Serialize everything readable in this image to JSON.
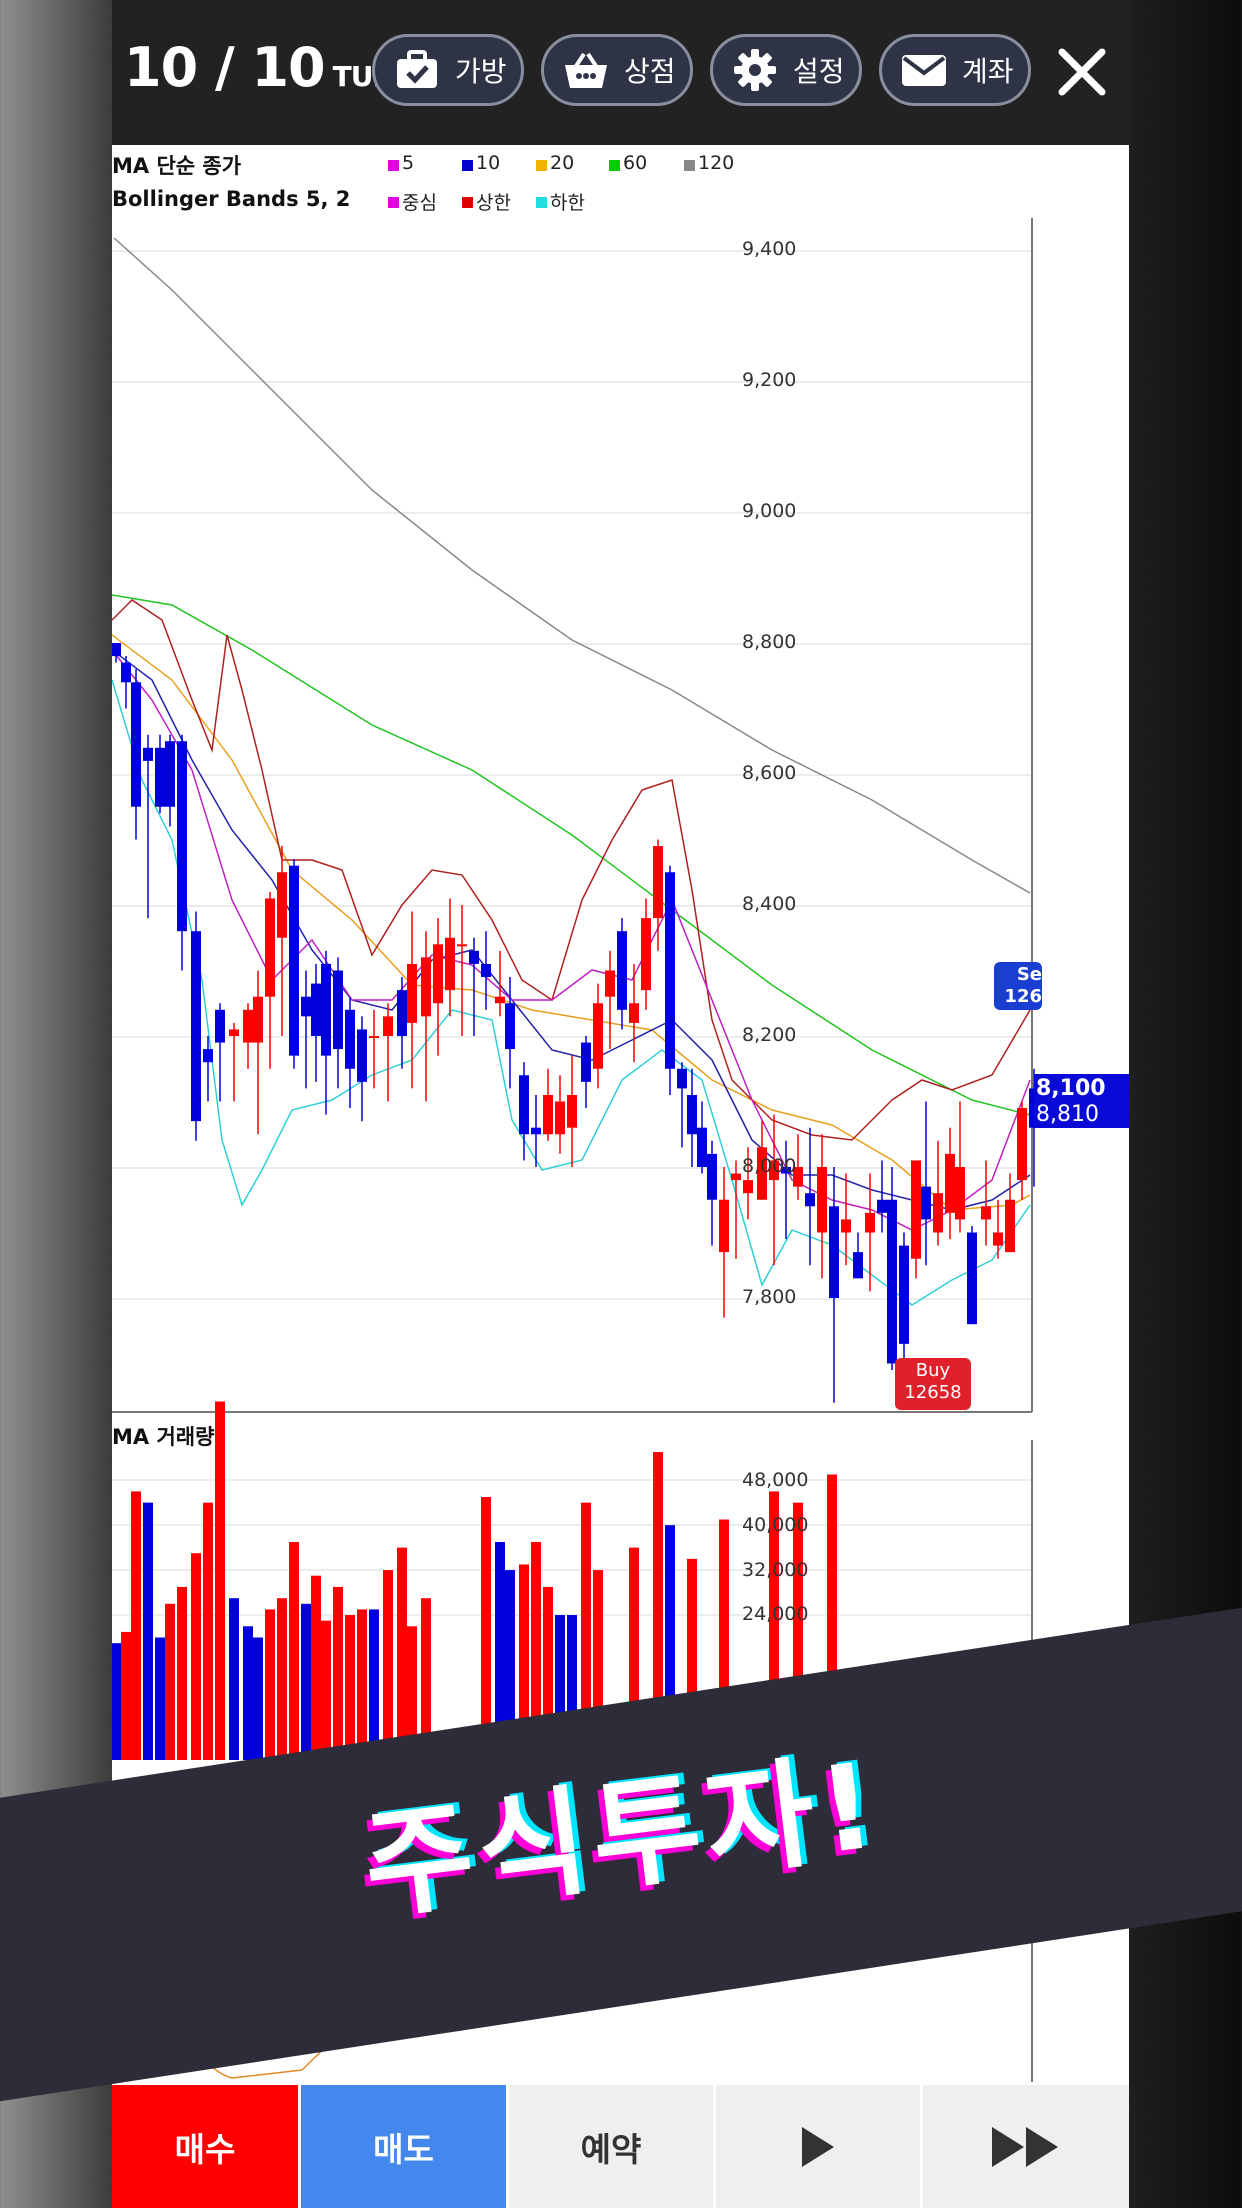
{
  "header": {
    "turn_main": "10 / 10",
    "turn_suffix": "TURN",
    "buttons": [
      {
        "label": "가방",
        "icon": "briefcase-check-icon"
      },
      {
        "label": "상점",
        "icon": "shopping-basket-icon"
      },
      {
        "label": "설정",
        "icon": "gear-icon"
      },
      {
        "label": "계좌",
        "icon": "envelope-icon"
      }
    ],
    "close_icon": "close-icon"
  },
  "legend": {
    "ma_title": "MA 단순 종가",
    "ma_items": [
      {
        "label": "5",
        "color": "#e000e0"
      },
      {
        "label": "10",
        "color": "#0000cc"
      },
      {
        "label": "20",
        "color": "#f0b400"
      },
      {
        "label": "60",
        "color": "#00cc00"
      },
      {
        "label": "120",
        "color": "#888888"
      }
    ],
    "bb_title": "Bollinger Bands 5, 2",
    "bb_items": [
      {
        "label": "중심",
        "color": "#e000e0"
      },
      {
        "label": "상한",
        "color": "#dd0000"
      },
      {
        "label": "하한",
        "color": "#22dddd"
      }
    ]
  },
  "price_axis": [
    "9,400",
    "9,200",
    "9,000",
    "8,800",
    "8,600",
    "8,400",
    "8,200",
    "8,000",
    "7,800"
  ],
  "markers": {
    "sell_label": "Se",
    "sell_value": "126",
    "buy_label": "Buy",
    "buy_value": "12658",
    "current_price": "8,100",
    "secondary_price": "8,810"
  },
  "volume": {
    "title": "MA 거래량",
    "axis": [
      "48,000",
      "40,000",
      "32,000",
      "24,000"
    ]
  },
  "banner": {
    "text": "주식투자!"
  },
  "bottom_bar": {
    "buy_label": "매수",
    "sell_label": "매도",
    "reserve_label": "예약",
    "play_icon": "play-icon",
    "fast_forward_icon": "fast-forward-icon"
  },
  "colors": {
    "rise": "#ff0000",
    "fall": "#0000dd",
    "buy_button": "#ff0000",
    "sell_button": "#4488ee"
  }
}
